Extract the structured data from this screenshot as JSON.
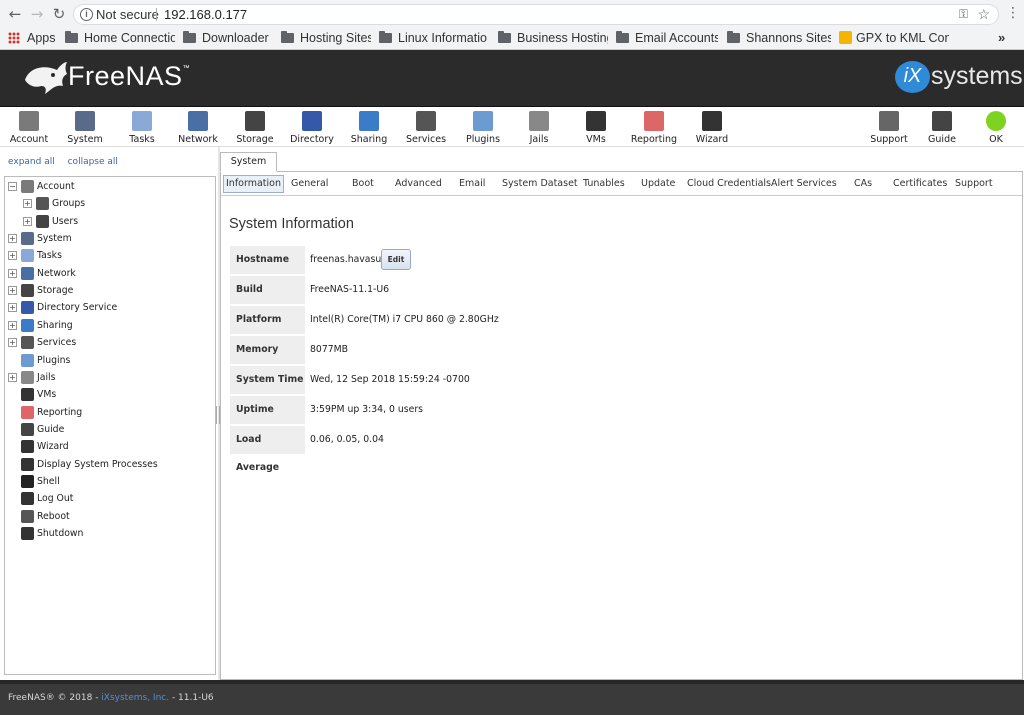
{
  "browser": {
    "security": "Not secure",
    "url": "192.168.0.177",
    "bookmarks": [
      {
        "label": "Apps",
        "icon": "apps-grid-icon"
      },
      {
        "label": "Home Connectio",
        "icon": "folder-icon"
      },
      {
        "label": "Downloader",
        "icon": "folder-icon"
      },
      {
        "label": "Hosting Sites",
        "icon": "folder-icon"
      },
      {
        "label": "Linux Informatio",
        "icon": "folder-icon"
      },
      {
        "label": "Business Hosting",
        "icon": "folder-icon"
      },
      {
        "label": "Email Accounts",
        "icon": "folder-icon"
      },
      {
        "label": "Shannons Sites",
        "icon": "folder-icon"
      },
      {
        "label": "GPX to KML Con",
        "icon": "map-pin-icon"
      }
    ],
    "more": "»"
  },
  "header": {
    "brand": "FreeNAS",
    "brand_mark": "™",
    "vendor_ix": "iX",
    "vendor_rest": "systems"
  },
  "toolbar": {
    "left": [
      {
        "label": "Account",
        "icon": "users-icon"
      },
      {
        "label": "System",
        "icon": "system-icon"
      },
      {
        "label": "Tasks",
        "icon": "calendar-icon"
      },
      {
        "label": "Network",
        "icon": "network-icon"
      },
      {
        "label": "Storage",
        "icon": "storage-icon"
      },
      {
        "label": "Directory",
        "icon": "directory-icon"
      },
      {
        "label": "Sharing",
        "icon": "sharing-icon"
      },
      {
        "label": "Services",
        "icon": "gears-icon"
      },
      {
        "label": "Plugins",
        "icon": "puzzle-icon"
      },
      {
        "label": "Jails",
        "icon": "jail-bars-icon"
      },
      {
        "label": "VMs",
        "icon": "monitor-icon"
      },
      {
        "label": "Reporting",
        "icon": "report-icon"
      },
      {
        "label": "Wizard",
        "icon": "wizard-hat-icon"
      }
    ],
    "right": [
      {
        "label": "Support",
        "icon": "support-icon"
      },
      {
        "label": "Guide",
        "icon": "book-icon"
      },
      {
        "label": "OK",
        "icon": "ok-light-icon"
      }
    ]
  },
  "sidebar": {
    "expand_all": "expand all",
    "collapse_all": "collapse all",
    "tree": [
      {
        "label": "Account",
        "expander": "−",
        "icon": "users-icon",
        "level": 0
      },
      {
        "label": "Groups",
        "expander": "+",
        "icon": "groups-icon",
        "level": 1
      },
      {
        "label": "Users",
        "expander": "+",
        "icon": "user-icon",
        "level": 1
      },
      {
        "label": "System",
        "expander": "+",
        "icon": "system-icon",
        "level": 0
      },
      {
        "label": "Tasks",
        "expander": "+",
        "icon": "calendar-icon",
        "level": 0
      },
      {
        "label": "Network",
        "expander": "+",
        "icon": "network-icon",
        "level": 0
      },
      {
        "label": "Storage",
        "expander": "+",
        "icon": "storage-icon",
        "level": 0
      },
      {
        "label": "Directory Service",
        "expander": "+",
        "icon": "directory-icon",
        "level": 0
      },
      {
        "label": "Sharing",
        "expander": "+",
        "icon": "sharing-icon",
        "level": 0
      },
      {
        "label": "Services",
        "expander": "+",
        "icon": "gears-icon",
        "level": 0
      },
      {
        "label": "Plugins",
        "expander": "",
        "icon": "puzzle-icon",
        "level": 0
      },
      {
        "label": "Jails",
        "expander": "+",
        "icon": "jail-bars-icon",
        "level": 0
      },
      {
        "label": "VMs",
        "expander": "",
        "icon": "monitor-icon",
        "level": 0
      },
      {
        "label": "Reporting",
        "expander": "",
        "icon": "report-icon",
        "level": 0
      },
      {
        "label": "Guide",
        "expander": "",
        "icon": "book-icon",
        "level": 0
      },
      {
        "label": "Wizard",
        "expander": "",
        "icon": "wizard-hat-icon",
        "level": 0
      },
      {
        "label": "Display System Processes",
        "expander": "",
        "icon": "processes-icon",
        "level": 0
      },
      {
        "label": "Shell",
        "expander": "",
        "icon": "shell-icon",
        "level": 0
      },
      {
        "label": "Log Out",
        "expander": "",
        "icon": "logout-icon",
        "level": 0
      },
      {
        "label": "Reboot",
        "expander": "",
        "icon": "reboot-icon",
        "level": 0
      },
      {
        "label": "Shutdown",
        "expander": "",
        "icon": "shutdown-icon",
        "level": 0
      }
    ]
  },
  "main": {
    "tab": "System",
    "subtabs": [
      "Information",
      "General",
      "Boot",
      "Advanced",
      "Email",
      "System Dataset",
      "Tunables",
      "Update",
      "Cloud Credentials",
      "Alert Services",
      "CAs",
      "Certificates",
      "Support"
    ],
    "active_subtab": "Information",
    "section_title": "System Information",
    "edit_label": "Edit",
    "info": [
      {
        "key": "Hostname",
        "value": "freenas.havasu"
      },
      {
        "key": "Build",
        "value": "FreeNAS-11.1-U6"
      },
      {
        "key": "Platform",
        "value": "Intel(R) Core(TM) i7 CPU 860 @ 2.80GHz"
      },
      {
        "key": "Memory",
        "value": "8077MB"
      },
      {
        "key": "System Time",
        "value": "Wed, 12 Sep 2018 15:59:24 -0700"
      },
      {
        "key": "Uptime",
        "value": "3:59PM up 3:34, 0 users"
      },
      {
        "key": "Load Average",
        "value": "0.06, 0.05, 0.04"
      }
    ]
  },
  "footer": {
    "prefix": "FreeNAS® © 2018 - ",
    "link": "iXsystems, Inc.",
    "suffix": " - 11.1-U6"
  },
  "colors": {
    "banner": "#2b2b2b",
    "ix_blue": "#2f8ad8",
    "link": "#3a66a7",
    "ok_green": "#7ed321"
  }
}
